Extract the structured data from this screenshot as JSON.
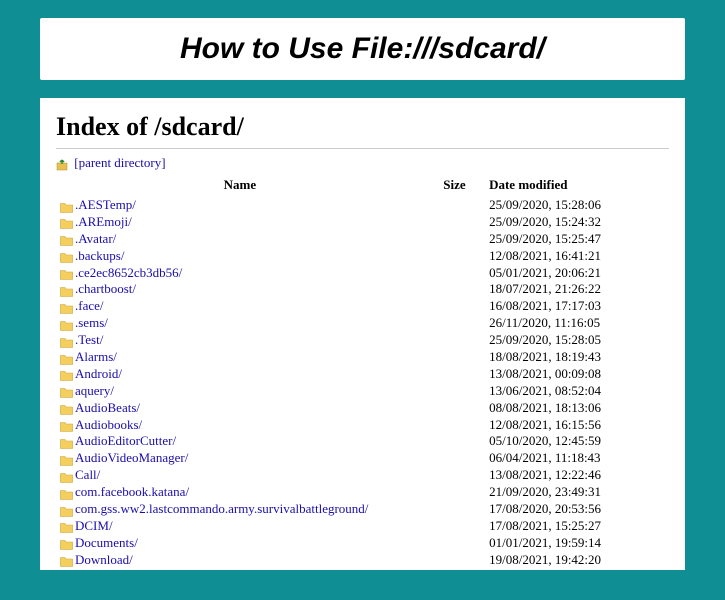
{
  "title": "How to Use File:///sdcard/",
  "index_heading": "Index of /sdcard/",
  "parent_label": "[parent directory]",
  "columns": {
    "name": "Name",
    "size": "Size",
    "date": "Date modified"
  },
  "entries": [
    {
      "name": ".AESTemp/",
      "size": "",
      "date": "25/09/2020, 15:28:06"
    },
    {
      "name": ".AREmoji/",
      "size": "",
      "date": "25/09/2020, 15:24:32"
    },
    {
      "name": ".Avatar/",
      "size": "",
      "date": "25/09/2020, 15:25:47"
    },
    {
      "name": ".backups/",
      "size": "",
      "date": "12/08/2021, 16:41:21"
    },
    {
      "name": ".ce2ec8652cb3db56/",
      "size": "",
      "date": "05/01/2021, 20:06:21"
    },
    {
      "name": ".chartboost/",
      "size": "",
      "date": "18/07/2021, 21:26:22"
    },
    {
      "name": ".face/",
      "size": "",
      "date": "16/08/2021, 17:17:03"
    },
    {
      "name": ".sems/",
      "size": "",
      "date": "26/11/2020, 11:16:05"
    },
    {
      "name": ".Test/",
      "size": "",
      "date": "25/09/2020, 15:28:05"
    },
    {
      "name": "Alarms/",
      "size": "",
      "date": "18/08/2021, 18:19:43"
    },
    {
      "name": "Android/",
      "size": "",
      "date": "13/08/2021, 00:09:08"
    },
    {
      "name": "aquery/",
      "size": "",
      "date": "13/06/2021, 08:52:04"
    },
    {
      "name": "AudioBeats/",
      "size": "",
      "date": "08/08/2021, 18:13:06"
    },
    {
      "name": "Audiobooks/",
      "size": "",
      "date": "12/08/2021, 16:15:56"
    },
    {
      "name": "AudioEditorCutter/",
      "size": "",
      "date": "05/10/2020, 12:45:59"
    },
    {
      "name": "AudioVideoManager/",
      "size": "",
      "date": "06/04/2021, 11:18:43"
    },
    {
      "name": "Call/",
      "size": "",
      "date": "13/08/2021, 12:22:46"
    },
    {
      "name": "com.facebook.katana/",
      "size": "",
      "date": "21/09/2020, 23:49:31"
    },
    {
      "name": "com.gss.ww2.lastcommando.army.survivalbattleground/",
      "size": "",
      "date": "17/08/2020, 20:53:56"
    },
    {
      "name": "DCIM/",
      "size": "",
      "date": "17/08/2021, 15:25:27"
    },
    {
      "name": "Documents/",
      "size": "",
      "date": "01/01/2021, 19:59:14"
    },
    {
      "name": "Download/",
      "size": "",
      "date": "19/08/2021, 19:42:20"
    }
  ]
}
